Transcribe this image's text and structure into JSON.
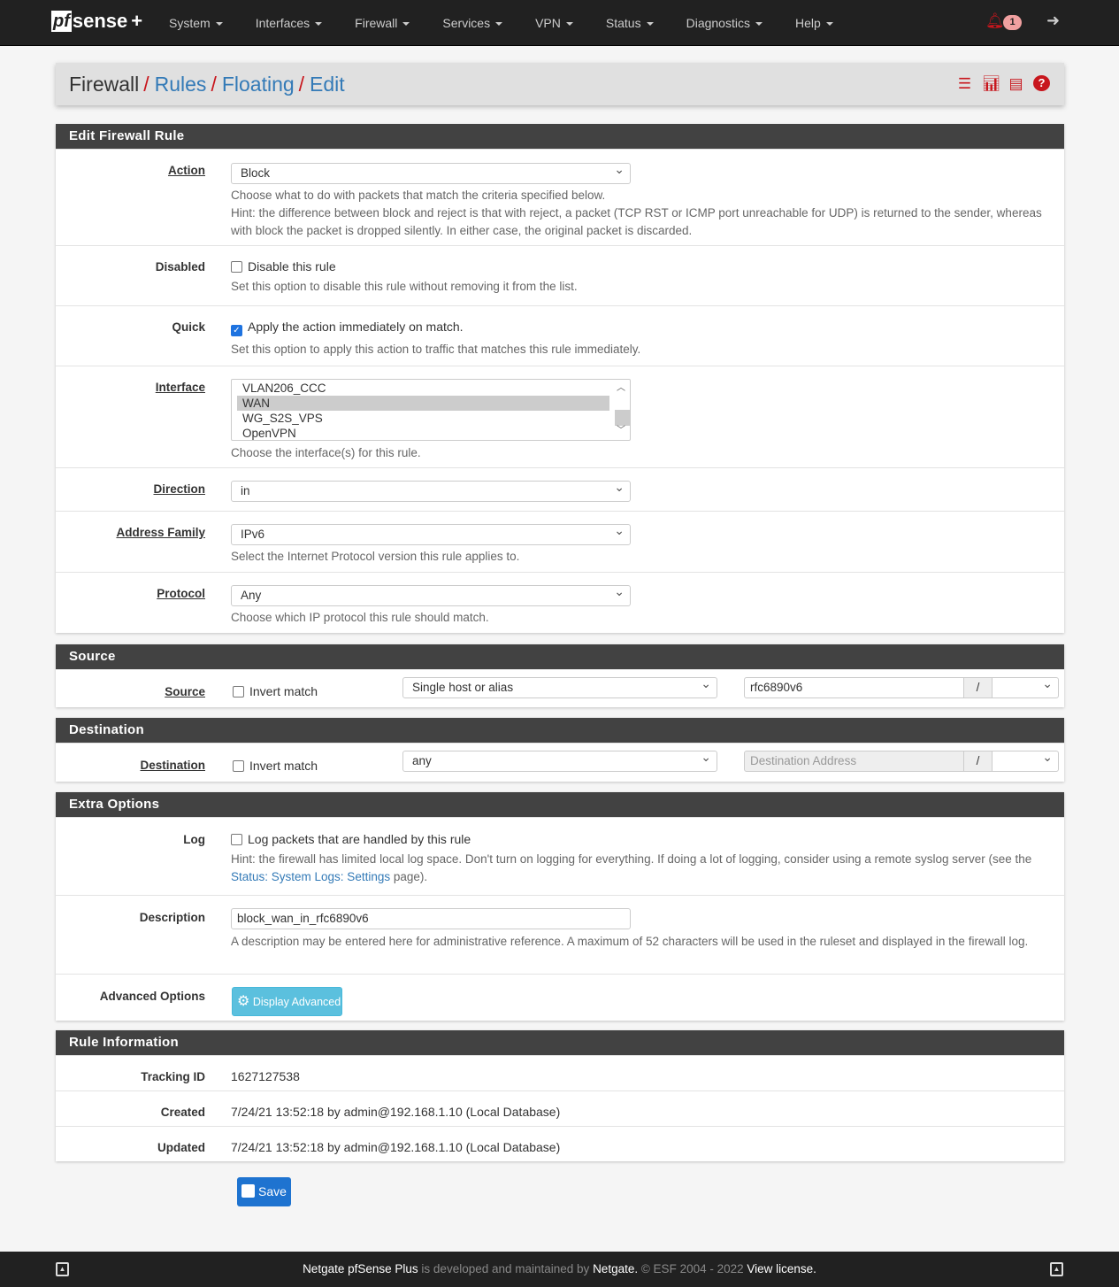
{
  "brand": {
    "logo_pf": "pf",
    "logo_rest": "sense",
    "logo_plus": "+"
  },
  "nav": {
    "items": [
      "System",
      "Interfaces",
      "Firewall",
      "Services",
      "VPN",
      "Status",
      "Diagnostics",
      "Help"
    ],
    "notification_count": "1"
  },
  "breadcrumb": {
    "root": "Firewall",
    "items": [
      "Rules",
      "Floating",
      "Edit"
    ]
  },
  "edit": {
    "title": "Edit Firewall Rule",
    "action": {
      "label": "Action",
      "value": "Block",
      "help1": "Choose what to do with packets that match the criteria specified below.",
      "help2": "Hint: the difference between block and reject is that with reject, a packet (TCP RST or ICMP port unreachable for UDP) is returned to the sender, whereas with block the packet is dropped silently. In either case, the original packet is discarded."
    },
    "disabled": {
      "label": "Disabled",
      "checkbox": "Disable this rule",
      "checked": false,
      "help": "Set this option to disable this rule without removing it from the list."
    },
    "quick": {
      "label": "Quick",
      "checkbox": "Apply the action immediately on match.",
      "checked": true,
      "help": "Set this option to apply this action to traffic that matches this rule immediately."
    },
    "interface": {
      "label": "Interface",
      "options": [
        "VLAN206_CCC",
        "WAN",
        "WG_S2S_VPS",
        "OpenVPN"
      ],
      "selected": "WAN",
      "help": "Choose the interface(s) for this rule."
    },
    "direction": {
      "label": "Direction",
      "value": "in"
    },
    "address_family": {
      "label": "Address Family",
      "value": "IPv6",
      "help": "Select the Internet Protocol version this rule applies to."
    },
    "protocol": {
      "label": "Protocol",
      "value": "Any",
      "help": "Choose which IP protocol this rule should match."
    }
  },
  "source": {
    "title": "Source",
    "label": "Source",
    "invert": "Invert match",
    "type": "Single host or alias",
    "address": "rfc6890v6",
    "slash": "/"
  },
  "destination": {
    "title": "Destination",
    "label": "Destination",
    "invert": "Invert match",
    "type": "any",
    "address_placeholder": "Destination Address",
    "slash": "/"
  },
  "extra": {
    "title": "Extra Options",
    "log": {
      "label": "Log",
      "checkbox": "Log packets that are handled by this rule",
      "help_pre": "Hint: the firewall has limited local log space. Don't turn on logging for everything. If doing a lot of logging, consider using a remote syslog server (see the ",
      "help_link": "Status: System Logs: Settings",
      "help_post": " page)."
    },
    "description": {
      "label": "Description",
      "value": "block_wan_in_rfc6890v6",
      "help": "A description may be entered here for administrative reference. A maximum of 52 characters will be used in the ruleset and displayed in the firewall log."
    },
    "advanced": {
      "label": "Advanced Options",
      "button": "Display Advanced"
    }
  },
  "rule_info": {
    "title": "Rule Information",
    "tracking_label": "Tracking ID",
    "tracking": "1627127538",
    "created_label": "Created",
    "created": "7/24/21 13:52:18 by admin@192.168.1.10 (Local Database)",
    "updated_label": "Updated",
    "updated": "7/24/21 13:52:18 by admin@192.168.1.10 (Local Database)"
  },
  "save_label": "Save",
  "footer": {
    "a": "Netgate ",
    "b": "pfSense Plus",
    "c": " is developed and maintained by ",
    "d": "Netgate.",
    "e": " © ESF 2004 - 2022 ",
    "f": "View license."
  }
}
